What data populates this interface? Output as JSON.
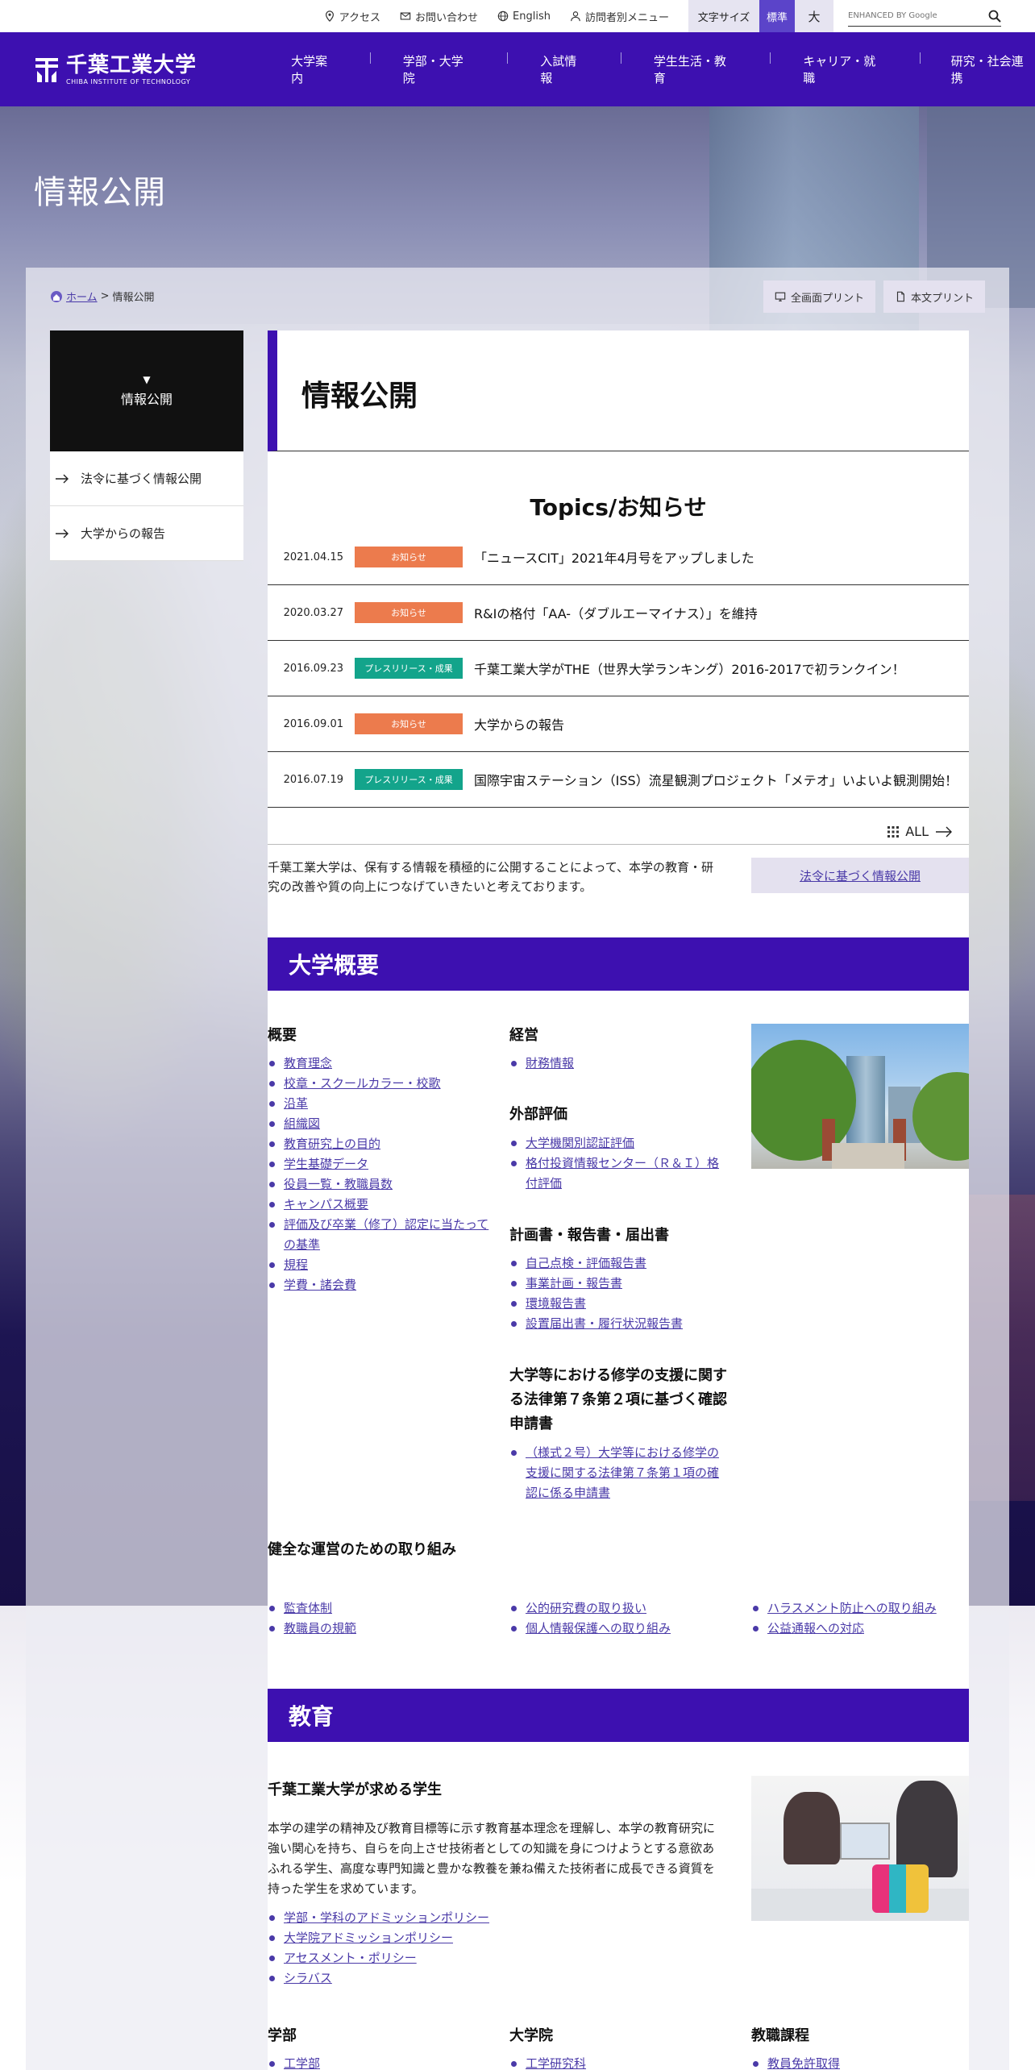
{
  "utility": {
    "access": "アクセス",
    "contact": "お問い合わせ",
    "english": "English",
    "visitor_menu": "訪問者別メニュー",
    "font_size_label": "文字サイズ",
    "font_std": "標準",
    "font_large": "大",
    "search_placeholder": "ENHANCED BY Google"
  },
  "brand": {
    "logo_ja": "千葉工業大学",
    "logo_en": "CHIBA INSTITUTE OF TECHNOLOGY",
    "accent_color": "#3d10b0"
  },
  "nav": [
    "大学案内",
    "学部・大学院",
    "入試情報",
    "学生生活・教育",
    "キャリア・就職",
    "研究・社会連携"
  ],
  "hero": {
    "title": "情報公開"
  },
  "breadcrumb": {
    "home": "ホーム",
    "sep": ">",
    "current": "情報公開"
  },
  "print": {
    "full": "全画面プリント",
    "body": "本文プリント"
  },
  "sidebar": {
    "marker": "▼",
    "current": "情報公開",
    "items": [
      "法令に基づく情報公開",
      "大学からの報告"
    ]
  },
  "page": {
    "title": "情報公開"
  },
  "topics": {
    "heading": "Topics/お知らせ",
    "items": [
      {
        "date": "2021.04.15",
        "tag": "お知らせ",
        "title": "「ニュースCIT」2021年4月号をアップしました"
      },
      {
        "date": "2020.03.27",
        "tag": "お知らせ",
        "title": "R&Iの格付「AA-（ダブルエーマイナス）」を維持"
      },
      {
        "date": "2016.09.23",
        "tag": "プレスリリース・成果",
        "title": "千葉工業大学がTHE（世界大学ランキング）2016-2017で初ランクイン！"
      },
      {
        "date": "2016.09.01",
        "tag": "お知らせ",
        "title": "大学からの報告"
      },
      {
        "date": "2016.07.19",
        "tag": "プレスリリース・成果",
        "title": "国際宇宙ステーション（ISS）流星観測プロジェクト「メテオ」いよいよ観測開始！"
      }
    ],
    "all_label": "ALL"
  },
  "intro": {
    "text": "千葉工業大学は、保有する情報を積極的に公開することによって、本学の教育・研究の改善や質の向上につなげていきたいと考えております。",
    "law_button": "法令に基づく情報公開"
  },
  "overview": {
    "heading": "大学概要",
    "gaiyou": {
      "title": "概要",
      "links": [
        "教育理念",
        "校章・スクールカラー・校歌",
        "沿革",
        "組織図",
        "教育研究上の目的",
        "学生基礎データ",
        "役員一覧・教職員数",
        "キャンパス概要",
        "評価及び卒業（修了）認定に当たっての基準",
        "規程",
        "学費・諸会費"
      ]
    },
    "keiei": {
      "title": "経営",
      "links": [
        "財務情報"
      ]
    },
    "gaibu": {
      "title": "外部評価",
      "links": [
        "大学機関別認証評価",
        "格付投資情報センター（Ｒ＆Ｉ）格付評価"
      ]
    },
    "keikaku": {
      "title": "計画書・報告書・届出書",
      "links": [
        "自己点検・評価報告書",
        "事業計画・報告書",
        "環境報告書",
        "設置届出書・履行状況報告書"
      ]
    },
    "shugaku": {
      "title": "大学等における修学の支援に関する法律第７条第２項に基づく確認申請書",
      "links": [
        "（様式２号）大学等における修学の支援に関する法律第７条第１項の確認に係る申請書"
      ]
    },
    "kenzen": {
      "title": "健全な運営のための取り組み",
      "col1": [
        "監査体制",
        "教職員の規範"
      ],
      "col2": [
        "公的研究費の取り扱い",
        "個人情報保護への取り組み"
      ],
      "col3": [
        "ハラスメント防止への取り組み",
        "公益通報への対応"
      ]
    }
  },
  "education": {
    "heading": "教育",
    "subhead": "千葉工業大学が求める学生",
    "body": "本学の建学の精神及び教育目標等に示す教育基本理念を理解し、本学の教育研究に強い関心を持ち、自らを向上させ技術者としての知識を身につけようとする意欲あふれる学生、高度な専門知識と豊かな教養を兼ね備えた技術者に成長できる資質を持った学生を求めています。",
    "links": [
      "学部・学科のアドミッションポリシー",
      "大学院アドミッションポリシー",
      "アセスメント・ポリシー",
      "シラバス"
    ],
    "gakubu": {
      "title": "学部",
      "links": [
        "工学部"
      ]
    },
    "daigakuin": {
      "title": "大学院",
      "links": [
        "工学研究科"
      ]
    },
    "kyoshoku": {
      "title": "教職課程",
      "links": [
        "教員免許取得"
      ]
    }
  }
}
